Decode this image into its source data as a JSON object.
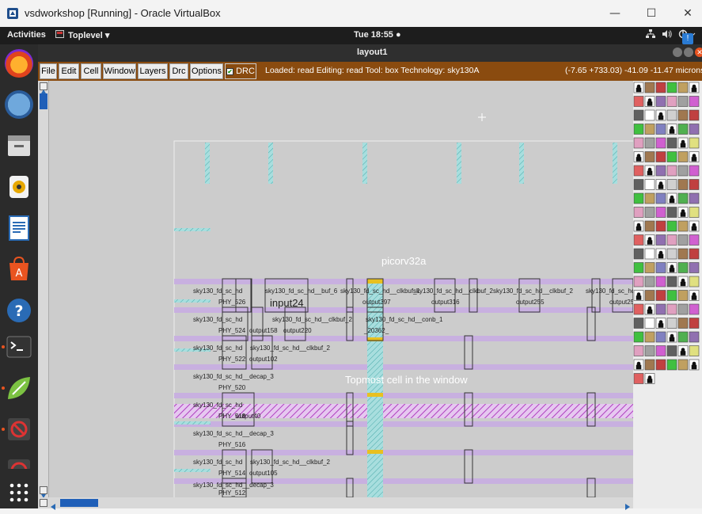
{
  "window": {
    "title": "vsdworkshop [Running] - Oracle VirtualBox",
    "minimize": "—",
    "maximize": "☐",
    "close": "✕"
  },
  "topbar": {
    "activities": "Activities",
    "app_menu": "Toplevel ▾",
    "clock": "Tue 18:55 ●"
  },
  "magic": {
    "title": "layout1",
    "menu": [
      "File",
      "Edit",
      "Cell",
      "Window",
      "Layers",
      "Drc",
      "Options"
    ],
    "drc_label": "DRC",
    "status": "Loaded: read Editing: read Tool: box  Technology: sky130A",
    "coords": "(-7.65 +733.03) -41.09 -11.47 microns"
  },
  "layout": {
    "cell_name": "picorv32a",
    "input_label": "input24",
    "topmost_label": "Topmost cell in the window",
    "cell_labels": [
      "sky130_fd_sc_hd__buf_6",
      "sky130_fd_sc_hd__clkbuf_1",
      "sky130_fd_sc_hd__clkbuf_2",
      "sky130_fd_sc_hd__clkbuf_2",
      "sky130_fd_sc_hd__clkbuf_2",
      "sky130_fd_sc_hd__clkbuf_2",
      "sky130_fd_sc_hd__conb_1",
      "sky130_fd_sc_hd__clkbuf_2",
      "sky130_fd_sc_hd__decap_3",
      "sky130_fd_sc_hd__decap_3",
      "sky130_fd_sc_hd__clkbuf_2",
      "sky130_fd_sc_hd__decap_3"
    ],
    "instance_labels": [
      "PHY_526",
      "output89",
      "output397",
      "output316",
      "output255",
      "output25",
      "PHY_524",
      "output158",
      "output220",
      "_20362_",
      "PHY_522",
      "output102",
      "PHY_520",
      "PHY_518",
      "output40",
      "PHY_516",
      "PHY_514",
      "output105",
      "PHY_512"
    ],
    "side_labels": [
      "sky130_fd_sc_hd",
      "sky130_fd_sc_hd",
      "sky130_fd_sc_hd",
      "sky130_fd_sc_hd",
      "sky130_fd_sc_hd",
      "sky130_fd_sc_hd",
      "sky130_fd_sc_hd",
      "sky130_fd_sc_hd",
      "sky130_fd_sc_hd"
    ]
  },
  "colors": {
    "menubar": "#8a4b0f",
    "canvas": "#cccccc",
    "metal_stripe": "#c8b0e0",
    "hatch": "#b040c0",
    "via": "#60c0c0"
  }
}
